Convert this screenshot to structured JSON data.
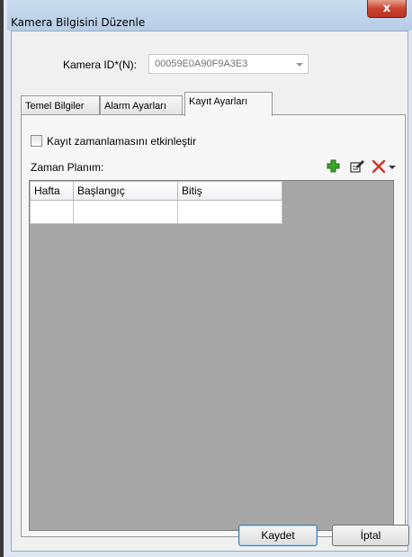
{
  "window": {
    "title": "Kamera Bilgisini Düzenle",
    "close_symbol": "x"
  },
  "camera": {
    "label": "Kamera ID*(N):",
    "value": "00059E0A90F9A3E3"
  },
  "tabs": [
    {
      "label": "Temel Bilgiler",
      "active": false
    },
    {
      "label": "Alarm Ayarları",
      "active": false
    },
    {
      "label": "Kayıt Ayarları",
      "active": true
    }
  ],
  "recording": {
    "enable_label": "Kayıt zamanlamasını etkinleştir",
    "enabled": false,
    "plan_label": "Zaman Planım:"
  },
  "toolbar": {
    "icons": [
      "add-icon",
      "edit-icon",
      "delete-icon",
      "dropdown-arrow-icon"
    ]
  },
  "schedule": {
    "columns": [
      "Hafta",
      "Başlangıç",
      "Bitiş"
    ],
    "rows": [
      [
        "",
        "",
        ""
      ]
    ]
  },
  "buttons": {
    "save": "Kaydet",
    "cancel": "İptal"
  },
  "colors": {
    "grid_background": "#a6a6a6",
    "delete_icon": "#d43124",
    "add_icon": "#3aa52b"
  }
}
